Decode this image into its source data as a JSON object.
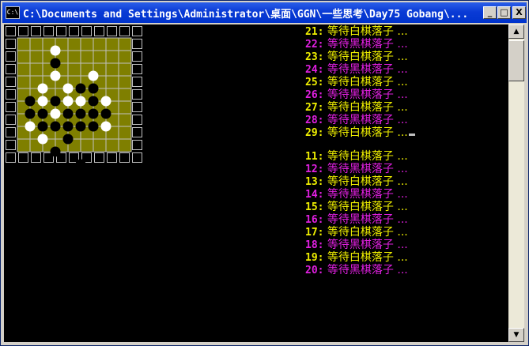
{
  "window": {
    "title": "C:\\Documents and Settings\\Administrator\\桌面\\GGN\\一些思考\\Day75 Gobang\\...",
    "icon_label": "C:\\",
    "minimize_label": "_",
    "maximize_label": "□",
    "close_label": "X"
  },
  "board": {
    "size": 11,
    "board_color": "#7f7f00",
    "black_stones": [
      [
        3,
        2
      ],
      [
        5,
        4
      ],
      [
        6,
        4
      ],
      [
        1,
        5
      ],
      [
        3,
        5
      ],
      [
        6,
        5
      ],
      [
        1,
        6
      ],
      [
        2,
        6
      ],
      [
        4,
        6
      ],
      [
        5,
        6
      ],
      [
        6,
        6
      ],
      [
        7,
        6
      ],
      [
        2,
        7
      ],
      [
        3,
        7
      ],
      [
        4,
        7
      ],
      [
        5,
        7
      ],
      [
        6,
        7
      ],
      [
        4,
        8
      ],
      [
        3,
        9
      ],
      [
        5,
        10
      ]
    ],
    "white_stones": [
      [
        3,
        1
      ],
      [
        3,
        3
      ],
      [
        4,
        4
      ],
      [
        6,
        3
      ],
      [
        2,
        4
      ],
      [
        2,
        5
      ],
      [
        4,
        5
      ],
      [
        5,
        5
      ],
      [
        7,
        5
      ],
      [
        3,
        6
      ],
      [
        7,
        7
      ],
      [
        1,
        7
      ],
      [
        2,
        8
      ]
    ]
  },
  "log": {
    "group1": [
      {
        "num": "21:",
        "msg": "等待白棋落子 ...",
        "color": "yellow"
      },
      {
        "num": "22:",
        "msg": "等待黑棋落子 ...",
        "color": "magenta"
      },
      {
        "num": "23:",
        "msg": "等待白棋落子 ...",
        "color": "yellow"
      },
      {
        "num": "24:",
        "msg": "等待黑棋落子 ...",
        "color": "magenta"
      },
      {
        "num": "25:",
        "msg": "等待白棋落子 ...",
        "color": "yellow"
      },
      {
        "num": "26:",
        "msg": "等待黑棋落子 ...",
        "color": "magenta"
      },
      {
        "num": "27:",
        "msg": "等待白棋落子 ...",
        "color": "yellow"
      },
      {
        "num": "28:",
        "msg": "等待黑棋落子 ...",
        "color": "magenta"
      },
      {
        "num": "29:",
        "msg": "等待白棋落子 ...",
        "color": "yellow"
      }
    ],
    "group2": [
      {
        "num": "11:",
        "msg": "等待白棋落子 ...",
        "color": "yellow"
      },
      {
        "num": "12:",
        "msg": "等待黑棋落子 ...",
        "color": "magenta"
      },
      {
        "num": "13:",
        "msg": "等待白棋落子 ...",
        "color": "yellow"
      },
      {
        "num": "14:",
        "msg": "等待黑棋落子 ...",
        "color": "magenta"
      },
      {
        "num": "15:",
        "msg": "等待白棋落子 ...",
        "color": "yellow"
      },
      {
        "num": "16:",
        "msg": "等待黑棋落子 ...",
        "color": "magenta"
      },
      {
        "num": "17:",
        "msg": "等待白棋落子 ...",
        "color": "yellow"
      },
      {
        "num": "18:",
        "msg": "等待黑棋落子 ...",
        "color": "magenta"
      },
      {
        "num": "19:",
        "msg": "等待白棋落子 ...",
        "color": "yellow"
      },
      {
        "num": "20:",
        "msg": "等待黑棋落子 ...",
        "color": "magenta"
      }
    ]
  },
  "colors": {
    "yellow": "#f0f000",
    "magenta": "#e020e0",
    "titlebar": "#0a3bd6"
  },
  "icons": {
    "title_icon": "console-icon",
    "scroll_up": "arrow-up-icon",
    "scroll_down": "arrow-down-icon"
  }
}
